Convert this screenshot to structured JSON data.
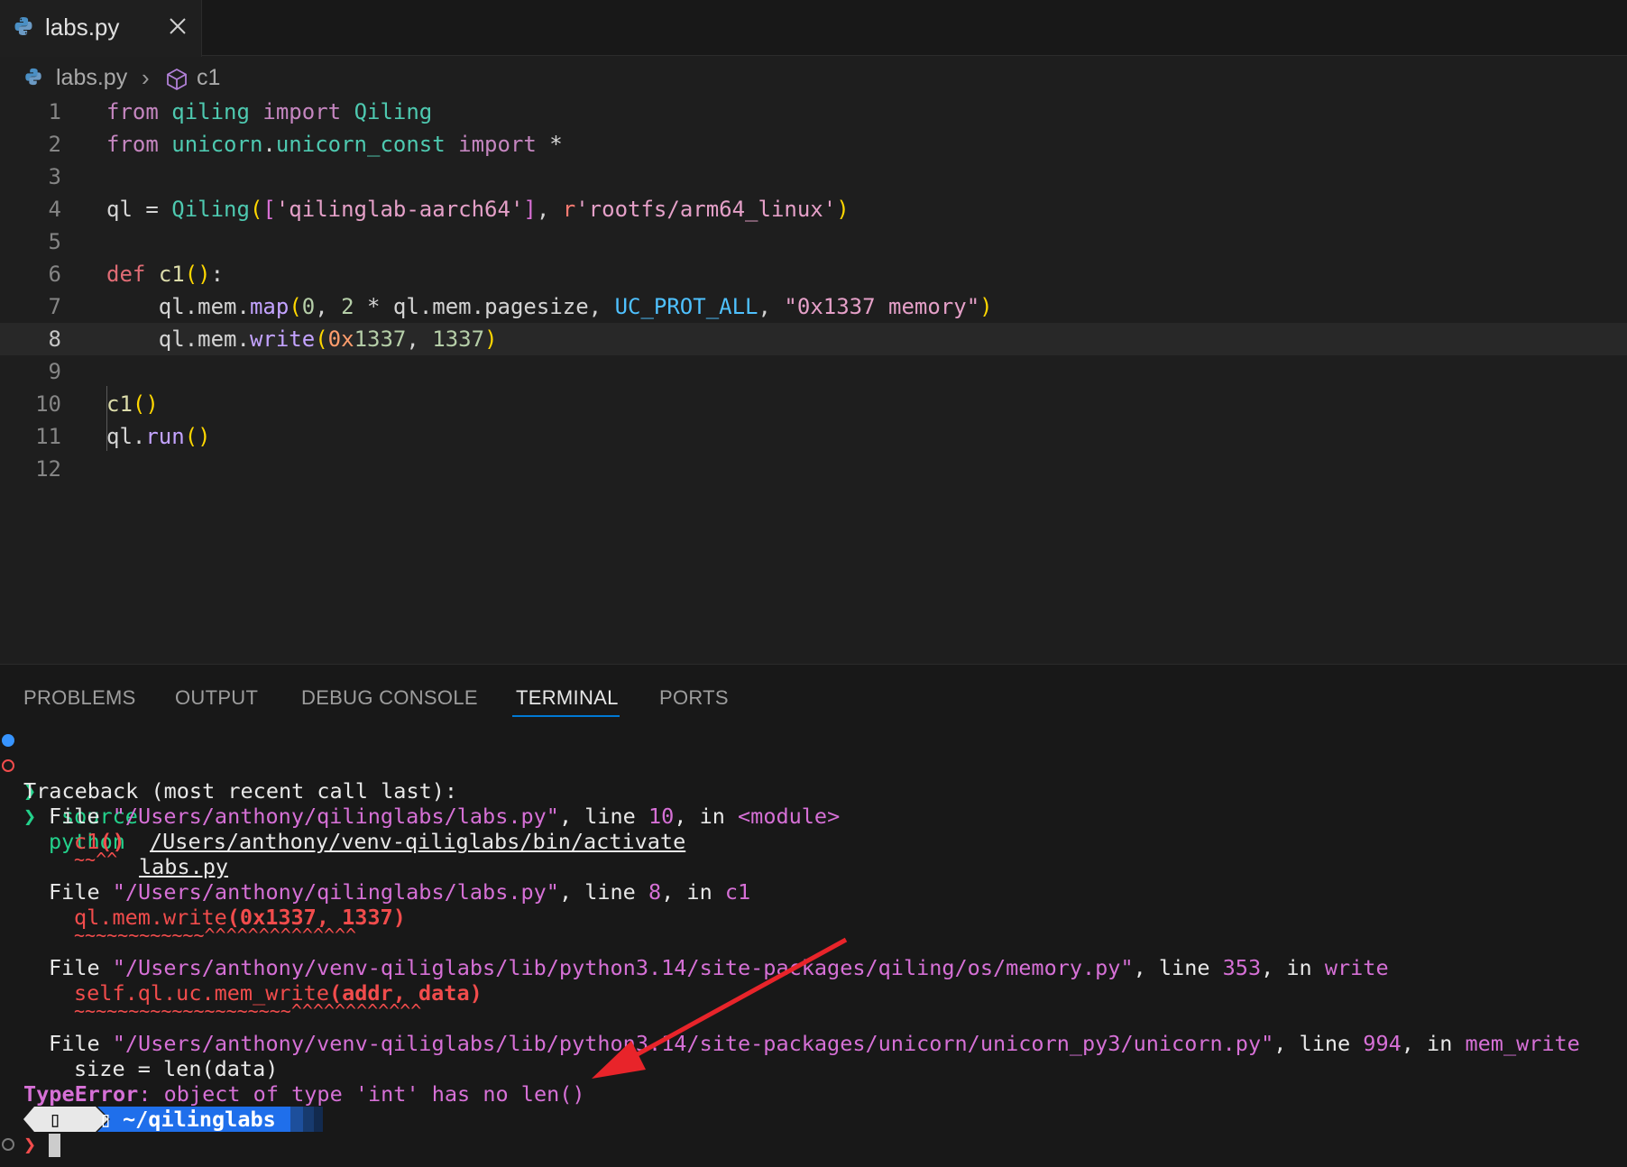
{
  "tab": {
    "label": "labs.py",
    "close_icon": "close-icon"
  },
  "breadcrumb": {
    "file": "labs.py",
    "separator": "›",
    "symbol": "c1"
  },
  "editor": {
    "line_numbers": [
      "1",
      "2",
      "3",
      "4",
      "5",
      "6",
      "7",
      "8",
      "9",
      "10",
      "11",
      "12"
    ],
    "active_line": "8",
    "lines": [
      [
        [
          "kw",
          "from"
        ],
        [
          "pl",
          " "
        ],
        [
          "cls",
          "qiling"
        ],
        [
          "pl",
          " "
        ],
        [
          "kw",
          "import"
        ],
        [
          "pl",
          " "
        ],
        [
          "cls",
          "Qiling"
        ]
      ],
      [
        [
          "kw",
          "from"
        ],
        [
          "pl",
          " "
        ],
        [
          "cls",
          "unicorn"
        ],
        [
          "pl",
          "."
        ],
        [
          "cls",
          "unicorn_const"
        ],
        [
          "pl",
          " "
        ],
        [
          "kw",
          "import"
        ],
        [
          "pl",
          " *"
        ]
      ],
      [],
      [
        [
          "pl",
          "ql = "
        ],
        [
          "cls",
          "Qiling"
        ],
        [
          "br1",
          "("
        ],
        [
          "br2",
          "["
        ],
        [
          "str2",
          "'qilinglab-aarch64'"
        ],
        [
          "br2",
          "]"
        ],
        [
          "pl",
          ", "
        ],
        [
          "rpre",
          "r"
        ],
        [
          "str2",
          "'rootfs/arm64_linux'"
        ],
        [
          "br1",
          ")"
        ]
      ],
      [],
      [
        [
          "kw2",
          "def"
        ],
        [
          "pl",
          " "
        ],
        [
          "fn",
          "c1"
        ],
        [
          "br1",
          "()"
        ],
        [
          "pl",
          ":"
        ]
      ],
      [
        [
          "pl",
          "    ql.mem."
        ],
        [
          "mth",
          "map"
        ],
        [
          "br1",
          "("
        ],
        [
          "num",
          "0"
        ],
        [
          "pl",
          ", "
        ],
        [
          "num",
          "2"
        ],
        [
          "pl",
          " * ql.mem.pagesize, "
        ],
        [
          "cst",
          "UC_PROT_ALL"
        ],
        [
          "pl",
          ", "
        ],
        [
          "str2",
          "\"0x1337 memory\""
        ],
        [
          "br1",
          ")"
        ]
      ],
      [
        [
          "pl",
          "    ql.mem."
        ],
        [
          "mth",
          "write"
        ],
        [
          "br1",
          "("
        ],
        [
          "hex",
          "0x"
        ],
        [
          "num",
          "1337"
        ],
        [
          "pl",
          ", "
        ],
        [
          "num",
          "1337"
        ],
        [
          "br1",
          ")"
        ]
      ],
      [],
      [
        [
          "fn",
          "c1"
        ],
        [
          "br1",
          "()"
        ]
      ],
      [
        [
          "pl",
          "ql."
        ],
        [
          "mth",
          "run"
        ],
        [
          "br1",
          "()"
        ]
      ],
      []
    ]
  },
  "panel": {
    "tabs": [
      "PROBLEMS",
      "OUTPUT",
      "DEBUG CONSOLE",
      "TERMINAL",
      "PORTS"
    ],
    "active_tab": "TERMINAL"
  },
  "terminal": {
    "prompt_char": "❯",
    "cmd1": {
      "name": "source",
      "arg": "/Users/anthony/venv-qiliglabs/bin/activate"
    },
    "cmd2": {
      "name": "python",
      "arg": "labs.py"
    },
    "traceback_header": "Traceback (most recent call last):",
    "frames": [
      {
        "file": "\"/Users/anthony/qilinglabs/labs.py\"",
        "line": "10",
        "func": "<module>",
        "code_a": "c1",
        "code_b": "()",
        "squig_a": "~~",
        "squig_b": "^^"
      },
      {
        "file": "\"/Users/anthony/qilinglabs/labs.py\"",
        "line": "8",
        "func": "c1",
        "code_a": "ql.mem.write",
        "code_b": "(0x1337, 1337)",
        "squig_a": "~~~~~~~~~~~~",
        "squig_b": "^^^^^^^^^^^^^^"
      },
      {
        "file": "\"/Users/anthony/venv-qiliglabs/lib/python3.14/site-packages/qiling/os/memory.py\"",
        "line": "353",
        "func": "write",
        "code_a": "self.ql.uc.mem_write",
        "code_b": "(addr, data)",
        "squig_a": "~~~~~~~~~~~~~~~~~~~~",
        "squig_b": "^^^^^^^^^^^^"
      },
      {
        "file": "\"/Users/anthony/venv-qiliglabs/lib/python3.14/site-packages/unicorn/unicorn_py3/unicorn.py\"",
        "line": "994",
        "func": "mem_write",
        "code": "size = len(data)"
      }
    ],
    "labels": {
      "file": "File ",
      "line": ", line ",
      "in": ", in "
    },
    "error_type": "TypeError",
    "error_msg": ": object of type 'int' has no len()",
    "prompt_path": "~/qilinglabs",
    "prompt_folder_glyph": "▯",
    "prompt_os_glyph": "▯"
  },
  "colors": {
    "accent": "#0078d4",
    "annotation_arrow": "#e8242a"
  }
}
